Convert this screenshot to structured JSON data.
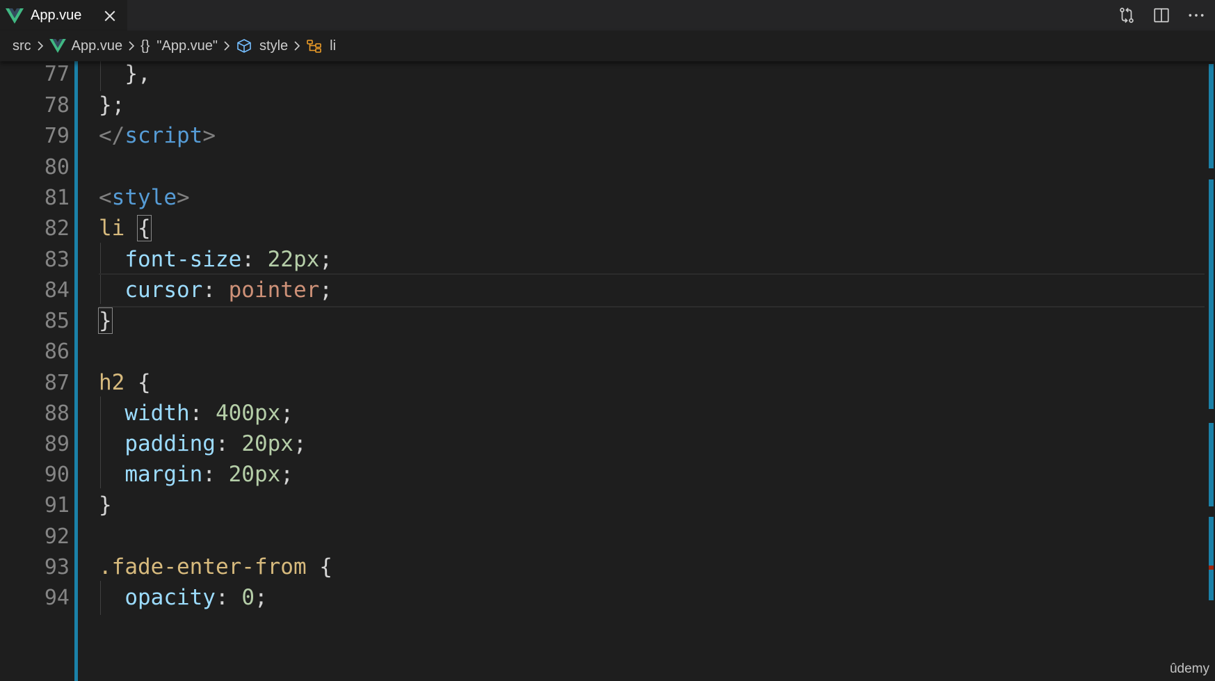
{
  "tab": {
    "label": "App.vue",
    "icon": "vue-icon",
    "close_icon": "close-icon"
  },
  "toolbar": {
    "actions": [
      "source-control-compare-icon",
      "split-editor-icon",
      "more-actions-icon"
    ]
  },
  "breadcrumb": {
    "items": [
      "src",
      "App.vue",
      "\"App.vue\"",
      "style",
      "li"
    ],
    "braces": "{}"
  },
  "editor": {
    "line_numbers": [
      "77",
      "78",
      "79",
      "80",
      "81",
      "82",
      "83",
      "84",
      "85",
      "86",
      "87",
      "88",
      "89",
      "90",
      "91",
      "92",
      "93",
      "94"
    ],
    "lines": {
      "l77_close": "},",
      "l78_close": "};",
      "l79_open": "</",
      "l79_tag": "script",
      "l79_close": ">",
      "l81_open": "<",
      "l81_tag": "style",
      "l81_close": ">",
      "l82_sel": "li",
      "l82_brace": "{",
      "l83_prop": "font-size",
      "l83_colon": ": ",
      "l83_val": "22px",
      "l83_semi": ";",
      "l84_prop": "cursor",
      "l84_colon": ": ",
      "l84_val": "pointer",
      "l84_semi": ";",
      "l85_brace": "}",
      "l87_sel": "h2",
      "l87_brace": "{",
      "l88_prop": "width",
      "l88_colon": ": ",
      "l88_val": "400px",
      "l88_semi": ";",
      "l89_prop": "padding",
      "l89_colon": ": ",
      "l89_val": "20px",
      "l89_semi": ";",
      "l90_prop": "margin",
      "l90_colon": ": ",
      "l90_val": "20px",
      "l90_semi": ";",
      "l91_brace": "}",
      "l93_sel": ".fade-enter-from",
      "l93_brace": "{",
      "l94_prop": "opacity",
      "l94_colon": ": ",
      "l94_val": "0",
      "l94_semi": ";"
    },
    "current_line": "84"
  },
  "watermark": "ûdemy",
  "colors": {
    "editor_bg": "#1e1e1e",
    "tab_bar_bg": "#252526",
    "keyword_blue": "#569cd6",
    "selector_yellow": "#d7ba7d",
    "property_lightblue": "#9cdcfe",
    "number_green": "#b5cea8",
    "string_orange": "#ce9178",
    "vue_green": "#41b883",
    "git_modified_blue": "#1b81a8"
  }
}
